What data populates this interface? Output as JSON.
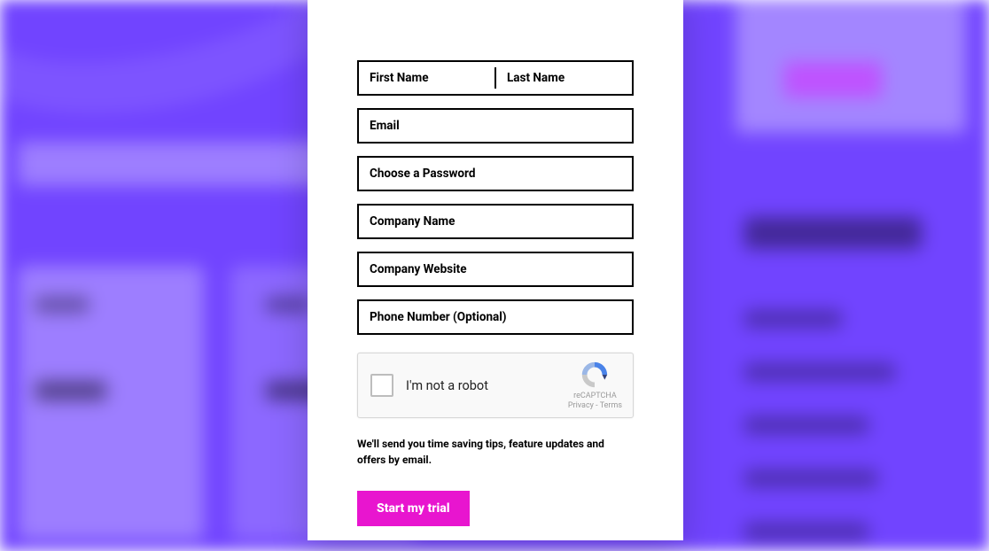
{
  "colors": {
    "accent": "#e815cf",
    "overlay": "#6c3fff"
  },
  "form": {
    "first_name": {
      "placeholder": "First Name",
      "value": ""
    },
    "last_name": {
      "placeholder": "Last Name",
      "value": ""
    },
    "email": {
      "placeholder": "Email",
      "value": ""
    },
    "password": {
      "placeholder": "Choose a Password",
      "value": ""
    },
    "company": {
      "placeholder": "Company Name",
      "value": ""
    },
    "website": {
      "placeholder": "Company Website",
      "value": ""
    },
    "phone": {
      "placeholder": "Phone Number (Optional)",
      "value": ""
    }
  },
  "captcha": {
    "checkbox_label": "I'm not a robot",
    "brand": "reCAPTCHA",
    "privacy": "Privacy",
    "terms": "Terms",
    "sep": " - "
  },
  "disclosure": "We'll send you time saving tips, feature updates and offers by email.",
  "submit_label": "Start my trial"
}
